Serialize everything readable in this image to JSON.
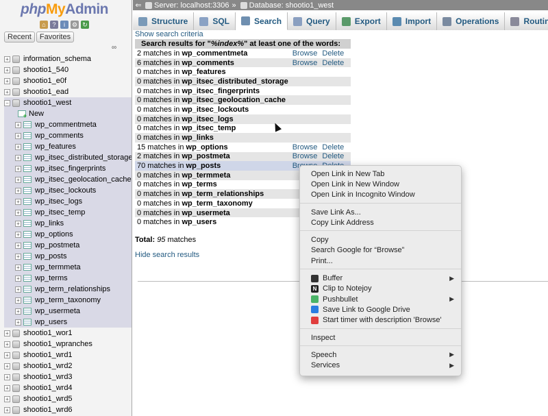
{
  "nav": {
    "logo": {
      "php": "php",
      "my": "My",
      "admin": "Admin"
    },
    "icons": [
      "home-icon",
      "docs-icon",
      "sql-docs-icon",
      "settings-icon",
      "reload-icon"
    ],
    "tabs": [
      "Recent",
      "Favorites"
    ],
    "databases_top": [
      "information_schema",
      "shootio1_540",
      "shootio1_e0f",
      "shootio1_ead",
      "shootio1_west"
    ],
    "new_label": "New",
    "tables": [
      "wp_commentmeta",
      "wp_comments",
      "wp_features",
      "wp_itsec_distributed_storage",
      "wp_itsec_fingerprints",
      "wp_itsec_geolocation_cache",
      "wp_itsec_lockouts",
      "wp_itsec_logs",
      "wp_itsec_temp",
      "wp_links",
      "wp_options",
      "wp_postmeta",
      "wp_posts",
      "wp_termmeta",
      "wp_terms",
      "wp_term_relationships",
      "wp_term_taxonomy",
      "wp_usermeta",
      "wp_users"
    ],
    "databases_bottom": [
      "shootio1_wor1",
      "shootio1_wpranches",
      "shootio1_wrd1",
      "shootio1_wrd2",
      "shootio1_wrd3",
      "shootio1_wrd4",
      "shootio1_wrd5",
      "shootio1_wrd6"
    ]
  },
  "breadcrumb": {
    "server": "Server: localhost:3306",
    "sep": "»",
    "database": "Database: shootio1_west"
  },
  "tabs": [
    {
      "label": "Structure",
      "icon": "structure-icon",
      "color": "#7a9ab8"
    },
    {
      "label": "SQL",
      "icon": "sql-icon",
      "color": "#8aa2c4"
    },
    {
      "label": "Search",
      "icon": "search-icon",
      "color": "#6f8fb0"
    },
    {
      "label": "Query",
      "icon": "query-icon",
      "color": "#8a9fc0"
    },
    {
      "label": "Export",
      "icon": "export-icon",
      "color": "#5a9a6a"
    },
    {
      "label": "Import",
      "icon": "import-icon",
      "color": "#5a8ab0"
    },
    {
      "label": "Operations",
      "icon": "operations-icon",
      "color": "#7a8aa0"
    },
    {
      "label": "Routines",
      "icon": "routines-icon",
      "color": "#8a8a9a"
    }
  ],
  "search": {
    "show_criteria": "Show search criteria",
    "header_prefix": "Search results for \"",
    "header_term": "%index%",
    "header_suffix": "\" at least one of the words:",
    "browse_label": "Browse",
    "delete_label": "Delete",
    "results": [
      {
        "count": "2 matches in",
        "table": "wp_commentmeta",
        "actions": true
      },
      {
        "count": "6 matches in",
        "table": "wp_comments",
        "actions": true
      },
      {
        "count": "0 matches in",
        "table": "wp_features",
        "actions": false
      },
      {
        "count": "0 matches in",
        "table": "wp_itsec_distributed_storage",
        "actions": false
      },
      {
        "count": "0 matches in",
        "table": "wp_itsec_fingerprints",
        "actions": false
      },
      {
        "count": "0 matches in",
        "table": "wp_itsec_geolocation_cache",
        "actions": false
      },
      {
        "count": "0 matches in",
        "table": "wp_itsec_lockouts",
        "actions": false
      },
      {
        "count": "0 matches in",
        "table": "wp_itsec_logs",
        "actions": false
      },
      {
        "count": "0 matches in",
        "table": "wp_itsec_temp",
        "actions": false
      },
      {
        "count": "0 matches in",
        "table": "wp_links",
        "actions": false
      },
      {
        "count": "15 matches in",
        "table": "wp_options",
        "actions": true
      },
      {
        "count": "2 matches in",
        "table": "wp_postmeta",
        "actions": true
      },
      {
        "count": "70 matches in",
        "table": "wp_posts",
        "actions": true
      },
      {
        "count": "0 matches in",
        "table": "wp_termmeta",
        "actions": false
      },
      {
        "count": "0 matches in",
        "table": "wp_terms",
        "actions": false
      },
      {
        "count": "0 matches in",
        "table": "wp_term_relationships",
        "actions": false
      },
      {
        "count": "0 matches in",
        "table": "wp_term_taxonomy",
        "actions": false
      },
      {
        "count": "0 matches in",
        "table": "wp_usermeta",
        "actions": false
      },
      {
        "count": "0 matches in",
        "table": "wp_users",
        "actions": false
      }
    ],
    "total_label": "Total:",
    "total_value": "95",
    "total_suffix": "matches",
    "hide_results": "Hide search results"
  },
  "context_menu": {
    "groups": [
      [
        {
          "label": "Open Link in New Tab"
        },
        {
          "label": "Open Link in New Window"
        },
        {
          "label": "Open Link in Incognito Window"
        }
      ],
      [
        {
          "label": "Save Link As..."
        },
        {
          "label": "Copy Link Address"
        }
      ],
      [
        {
          "label": "Copy"
        },
        {
          "label": "Search Google for “Browse”"
        },
        {
          "label": "Print..."
        }
      ],
      [
        {
          "label": "Buffer",
          "icon": "buffer-icon",
          "icon_color": "#333",
          "submenu": true
        },
        {
          "label": "Clip to Notejoy",
          "icon": "notejoy-icon",
          "icon_color": "#222",
          "glyph": "N"
        },
        {
          "label": "Pushbullet",
          "icon": "pushbullet-icon",
          "icon_color": "#4ab367",
          "submenu": true
        },
        {
          "label": "Save Link to Google Drive",
          "icon": "google-drive-icon",
          "icon_color": "#2a7de1"
        },
        {
          "label": "Start timer with description 'Browse'",
          "icon": "timer-icon",
          "icon_color": "#e03d3d"
        }
      ],
      [
        {
          "label": "Inspect"
        }
      ],
      [
        {
          "label": "Speech",
          "submenu": true
        },
        {
          "label": "Services",
          "submenu": true
        }
      ]
    ]
  }
}
